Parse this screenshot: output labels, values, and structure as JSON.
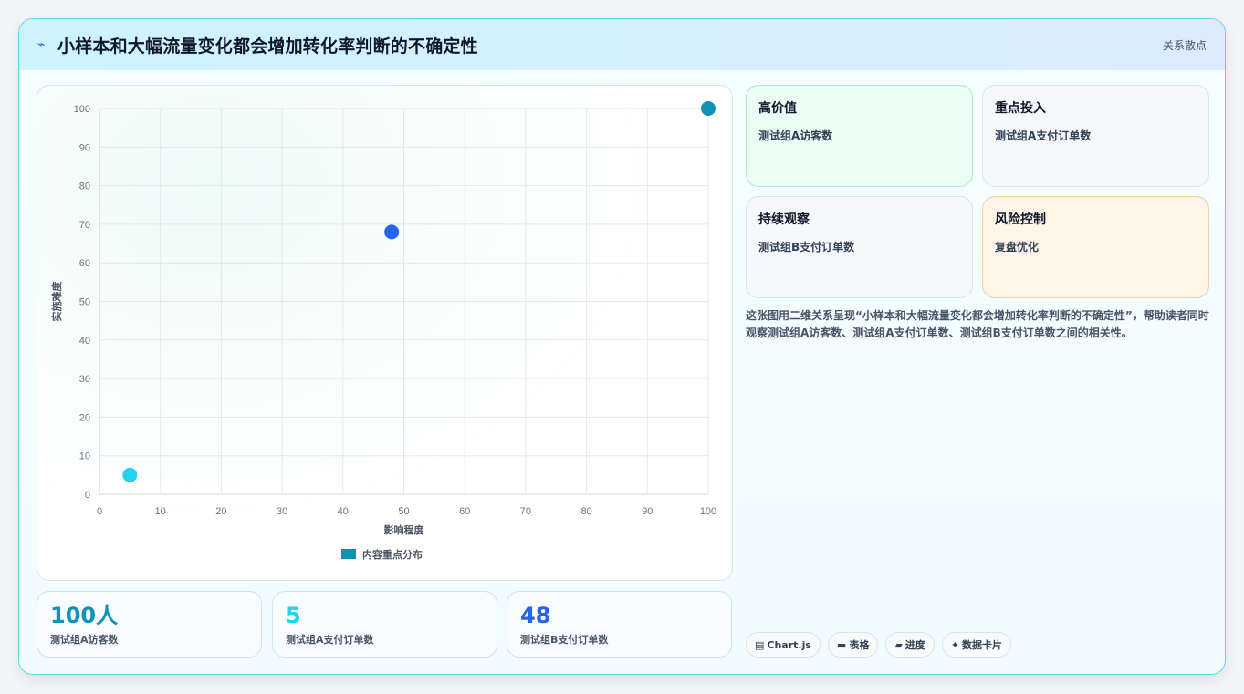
{
  "header": {
    "icon": "lightning-icon",
    "title": "小样本和大幅流量变化都会增加转化率判断的不确定性",
    "tag": "关系散点"
  },
  "colors": {
    "accent_teal": "#0e93b5",
    "accent_cyan": "#22d3ee",
    "accent_blue": "#2563eb",
    "grid": "#e5e7eb"
  },
  "chart_data": {
    "type": "scatter",
    "xlabel": "影响程度",
    "ylabel": "实施难度",
    "xlim": [
      0,
      100
    ],
    "ylim": [
      0,
      100
    ],
    "xticks": [
      0,
      10,
      20,
      30,
      40,
      50,
      60,
      70,
      80,
      90,
      100
    ],
    "yticks": [
      0,
      10,
      20,
      30,
      40,
      50,
      60,
      70,
      80,
      90,
      100
    ],
    "grid": true,
    "legend_position": "bottom",
    "series": [
      {
        "name": "内容重点分布",
        "color": "#0e93b5",
        "points": [
          {
            "x": 5,
            "y": 5,
            "color": "#22d3ee"
          },
          {
            "x": 48,
            "y": 68,
            "color": "#2563eb"
          },
          {
            "x": 100,
            "y": 100,
            "color": "#0e93b5"
          }
        ]
      }
    ]
  },
  "kpis": [
    {
      "value": "100人",
      "label": "测试组A访客数",
      "color": "#0e93b5"
    },
    {
      "value": "5",
      "label": "测试组A支付订单数",
      "color": "#22d3ee"
    },
    {
      "value": "48",
      "label": "测试组B支付订单数",
      "color": "#2563eb"
    }
  ],
  "tiles": [
    {
      "title": "高价值",
      "sub": "测试组A访客数"
    },
    {
      "title": "重点投入",
      "sub": "测试组A支付订单数"
    },
    {
      "title": "持续观察",
      "sub": "测试组B支付订单数"
    },
    {
      "title": "风险控制",
      "sub": "复盘优化"
    }
  ],
  "description": "这张图用二维关系呈现“小样本和大幅流量变化都会增加转化率判断的不确定性”，帮助读者同时观察测试组A访客数、测试组A支付订单数、测试组B支付订单数之间的相关性。",
  "chips": [
    {
      "icon": "chart-icon",
      "glyph": "▤",
      "label": "Chart.js"
    },
    {
      "icon": "table-icon",
      "glyph": "▬",
      "label": "表格"
    },
    {
      "icon": "progress-icon",
      "glyph": "▰",
      "label": "进度"
    },
    {
      "icon": "sparkle-icon",
      "glyph": "✦",
      "label": "数据卡片"
    }
  ]
}
